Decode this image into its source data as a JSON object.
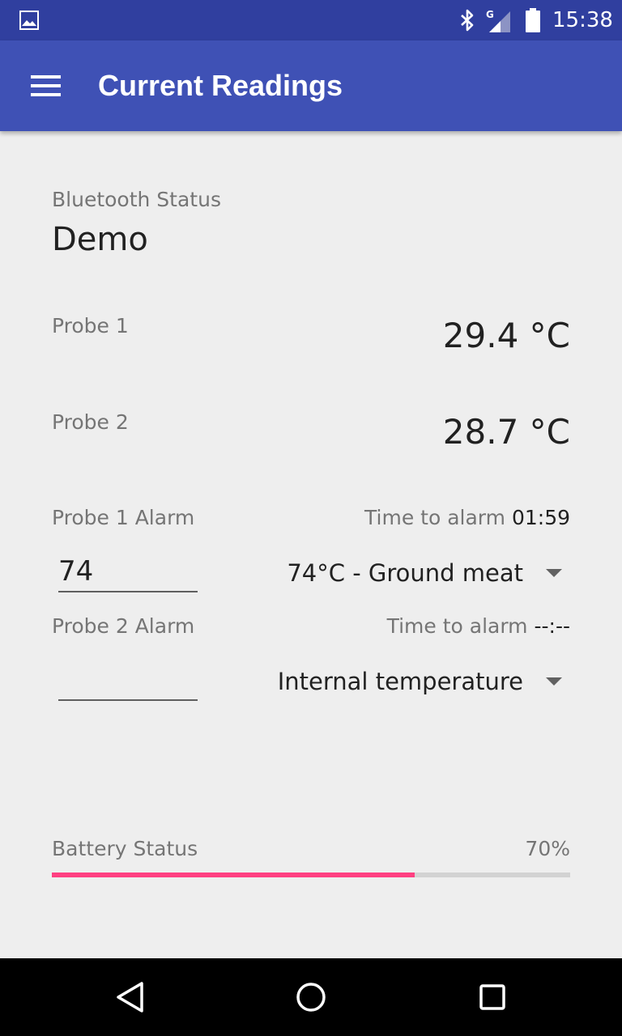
{
  "status_bar": {
    "time": "15:38",
    "icons": [
      "gallery-icon",
      "bluetooth-icon",
      "signal-icon",
      "battery-icon"
    ]
  },
  "app_bar": {
    "title": "Current Readings",
    "menu_icon": "menu-icon"
  },
  "bluetooth": {
    "label": "Bluetooth Status",
    "value": "Demo"
  },
  "probes": [
    {
      "label": "Probe 1",
      "value": "29.4 °C"
    },
    {
      "label": "Probe 2",
      "value": "28.7 °C"
    }
  ],
  "alarms": [
    {
      "label": "Probe 1 Alarm",
      "time_label": "Time to alarm",
      "time_value": "01:59",
      "input_value": "74",
      "preset": "74°C - Ground meat"
    },
    {
      "label": "Probe 2 Alarm",
      "time_label": "Time to alarm",
      "time_value": "--:--",
      "input_value": "",
      "preset": "Internal temperature"
    }
  ],
  "battery": {
    "label": "Battery Status",
    "value": "70%",
    "level": 0.7
  },
  "colors": {
    "status_bar": "#303f9f",
    "app_bar": "#3f51b5",
    "accent": "#ff4081",
    "background": "#eeeeee"
  },
  "nav_bar": {
    "icons": [
      "back-icon",
      "home-icon",
      "recent-apps-icon"
    ]
  }
}
